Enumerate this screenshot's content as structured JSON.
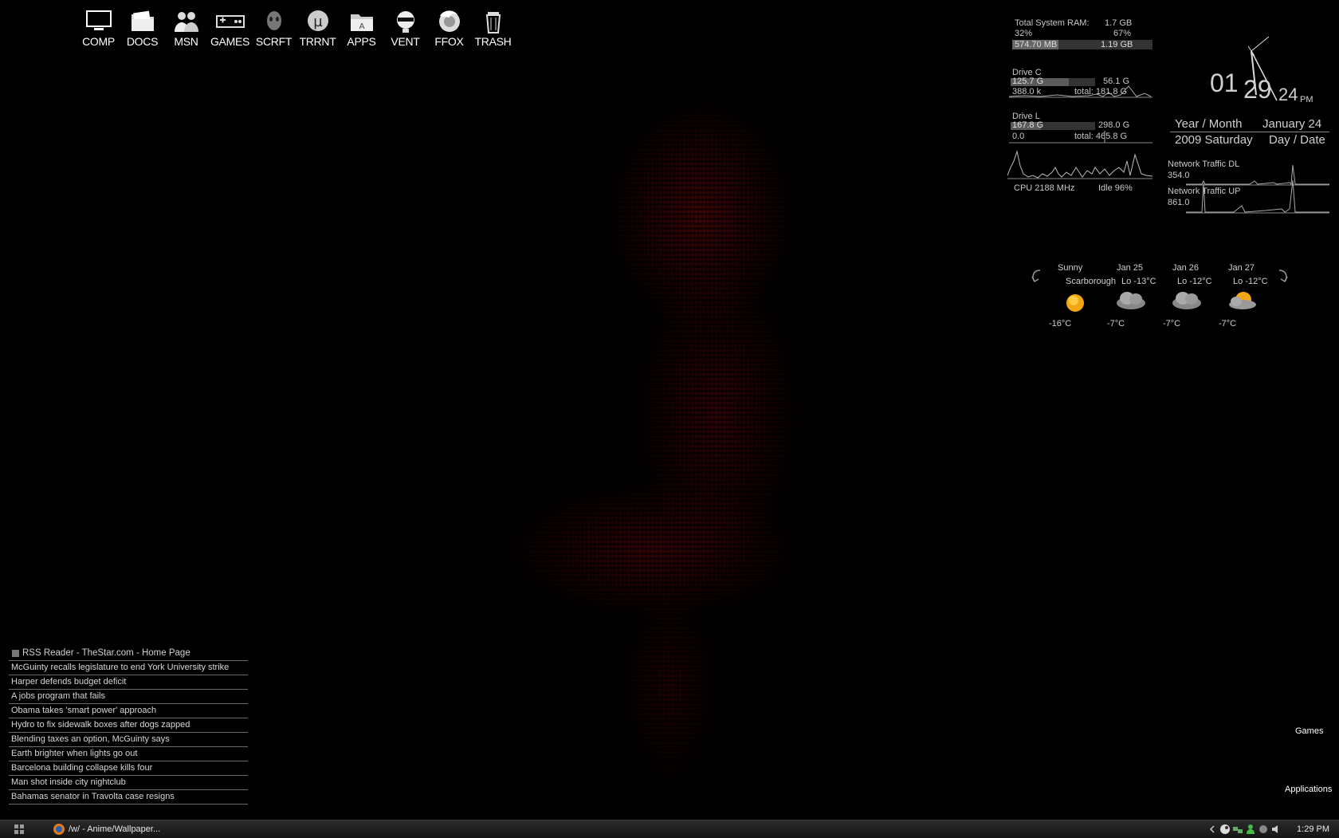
{
  "desktop_icons": [
    {
      "label": "COMP",
      "icon": "computer-icon"
    },
    {
      "label": "DOCS",
      "icon": "folder-icon"
    },
    {
      "label": "MSN",
      "icon": "msn-people-icon"
    },
    {
      "label": "GAMES",
      "icon": "gamepad-icon"
    },
    {
      "label": "SCRFT",
      "icon": "starcraft-icon"
    },
    {
      "label": "TRRNT",
      "icon": "utorrent-icon"
    },
    {
      "label": "APPS",
      "icon": "apps-folder-icon"
    },
    {
      "label": "VENT",
      "icon": "ventrilo-icon"
    },
    {
      "label": "FFOX",
      "icon": "firefox-icon"
    },
    {
      "label": "TRASH",
      "icon": "trash-icon"
    }
  ],
  "system": {
    "ram_label": "Total System RAM:",
    "ram_total": "1.7 GB",
    "ram_pct_left": "32%",
    "ram_pct_right": "67%",
    "ram_used": "574.70 MB",
    "ram_free": "1.19 GB",
    "ram_fraction": 0.33,
    "drive_c_label": "Drive C",
    "drive_c_used": "125.7 G",
    "drive_c_free": "56.1 G",
    "drive_c_rate": "388.0 k",
    "drive_c_total": "total: 181.8 G",
    "drive_c_fraction": 0.69,
    "drive_l_label": "Drive L",
    "drive_l_used": "167.8 G",
    "drive_l_free": "298.0 G",
    "drive_l_rate": "0.0",
    "drive_l_total": "total: 465.8 G",
    "drive_l_fraction": 0.36,
    "cpu": "CPU 2188 MHz",
    "idle": "Idle 96%"
  },
  "clock": {
    "hour": "01",
    "minute": "29",
    "second": "24",
    "ampm": "PM"
  },
  "calendar": {
    "year_month_label": "Year / Month",
    "month_day": "January 24",
    "year_weekday": "2009 Saturday",
    "day_date_label": "Day / Date"
  },
  "network": {
    "dl_label": "Network Traffic DL",
    "dl_value": "354.0",
    "up_label": "Network Traffic UP",
    "up_value": "861.0"
  },
  "weather": {
    "location": "Scarborough",
    "days": [
      {
        "label": "Sunny",
        "low": "",
        "temp": "-16°C",
        "icon": "sun-icon"
      },
      {
        "label": "Jan 25",
        "low": "Lo -13°C",
        "temp": "-7°C",
        "icon": "cloud-icon"
      },
      {
        "label": "Jan 26",
        "low": "Lo -12°C",
        "temp": "-7°C",
        "icon": "cloud-icon"
      },
      {
        "label": "Jan 27",
        "low": "Lo -12°C",
        "temp": "-7°C",
        "icon": "partly-sunny-icon"
      }
    ]
  },
  "rss": {
    "title": "RSS Reader - TheStar.com - Home Page",
    "items": [
      "McGuinty recalls legislature to end York University strike",
      "Harper defends budget deficit",
      "A jobs program that fails",
      "Obama takes 'smart power' approach",
      "Hydro to fix sidewalk boxes after dogs zapped",
      "Blending taxes an option, McGuinty says",
      "Earth brighter when lights go out",
      "Barcelona building collapse kills four",
      "Man shot inside city nightclub",
      "Bahamas senator in Travolta case resigns"
    ]
  },
  "shortcuts": {
    "games": "Games",
    "applications": "Applications"
  },
  "taskbar": {
    "window_title": "/w/ - Anime/Wallpaper...",
    "clock": "1:29 PM"
  }
}
